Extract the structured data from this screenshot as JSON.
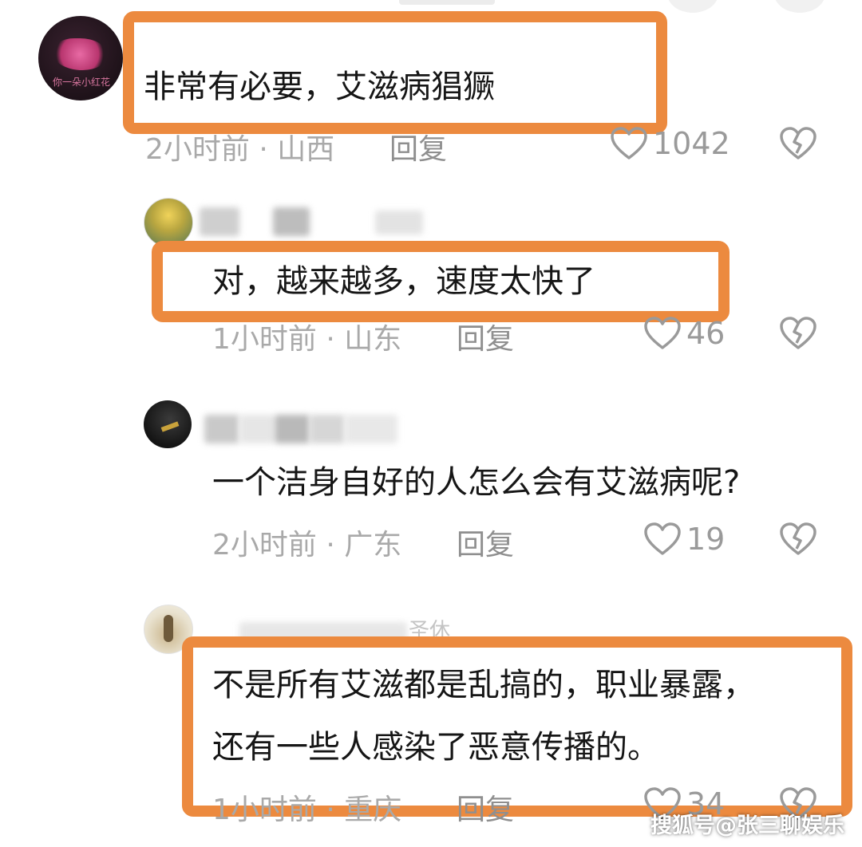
{
  "comments": [
    {
      "name_fragment": "",
      "avatar_text": "你一朵小红花",
      "text_lines": [
        "非常有必要，艾滋病猖獗"
      ],
      "meta": "2小时前 · 山西",
      "reply_label": "回复",
      "likes": "1042"
    },
    {
      "name_fragment": "",
      "text_lines": [
        "对，越来越多，速度太快了"
      ],
      "meta": "1小时前 · 山东",
      "reply_label": "回复",
      "likes": "46"
    },
    {
      "name_fragment": "",
      "text_lines": [
        "一个洁身自好的人怎么会有艾滋病呢?"
      ],
      "meta": "2小时前 · 广东",
      "reply_label": "回复",
      "likes": "19"
    },
    {
      "name_fragment": "圣休",
      "text_lines": [
        "不是所有艾滋都是乱搞的，职业暴露，",
        "还有一些人感染了恶意传播的。"
      ],
      "meta": "1小时前 · 重庆",
      "reply_label": "回复",
      "likes": "34"
    }
  ],
  "watermark": "搜狐号@张三聊娱乐",
  "colors": {
    "highlight_border": "#ec8a3f",
    "meta_text": "#a9a9a9",
    "icon_stroke": "#9a9a9a"
  },
  "icons": {
    "like": "heart-outline-icon",
    "dislike": "broken-heart-icon"
  }
}
